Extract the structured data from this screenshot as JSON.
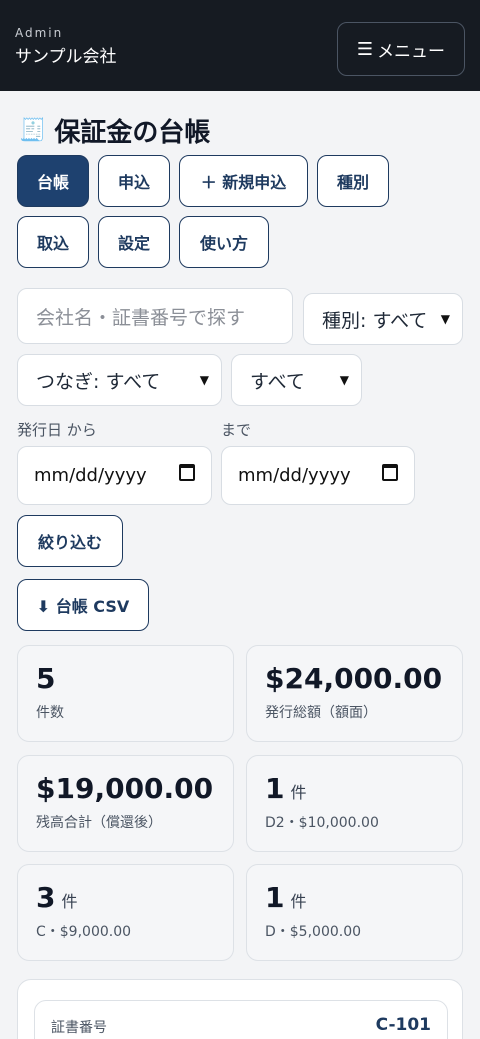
{
  "header": {
    "role": "Admin",
    "company": "サンプル会社",
    "menu_label": "メニュー",
    "menu_icon": "hamburger-icon"
  },
  "page": {
    "title": "保証金の台帳",
    "title_icon": "ledger-icon"
  },
  "tabs": [
    {
      "label": "台帳",
      "active": true
    },
    {
      "label": "申込",
      "active": false
    },
    {
      "label": "＋ 新規申込",
      "active": false
    },
    {
      "label": "種別",
      "active": false
    },
    {
      "label": "取込",
      "active": false
    },
    {
      "label": "設定",
      "active": false
    },
    {
      "label": "使い方",
      "active": false
    }
  ],
  "filters": {
    "search_placeholder": "会社名・証書番号で探す",
    "type_select": "種別: すべて",
    "bridge_select": "つなぎ: すべて",
    "status_select": "すべて",
    "date_from_label": "発行日 から",
    "date_to_label": "まで",
    "date_from_placeholder": "mm/dd/yyyy",
    "date_to_placeholder": "mm/dd/yyyy",
    "apply_label": "絞り込む",
    "csv_label": "⬇ 台帳 CSV"
  },
  "stats": [
    {
      "value": "5",
      "unit": "",
      "label": "件数"
    },
    {
      "value": "$24,000.00",
      "unit": "",
      "label": "発行総額（額面）"
    },
    {
      "value": "$19,000.00",
      "unit": "",
      "label": "残高合計（償還後）"
    },
    {
      "value": "1",
      "unit": "件",
      "label": "D2・$10,000.00"
    },
    {
      "value": "3",
      "unit": "件",
      "label": "C・$9,000.00"
    },
    {
      "value": "1",
      "unit": "件",
      "label": "D・$5,000.00"
    }
  ],
  "record": {
    "cert_label": "証書番号",
    "cert_value": "C-101"
  },
  "colors": {
    "topbar": "#161b22",
    "accent": "#1e3a5f",
    "active_tab": "#1e416f"
  }
}
